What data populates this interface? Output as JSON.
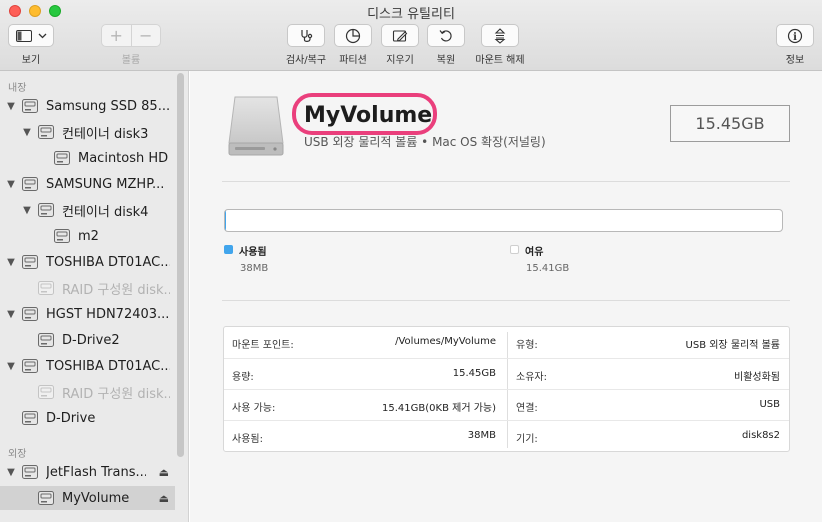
{
  "window": {
    "title": "디스크 유틸리티"
  },
  "toolbar": {
    "view_label": "보기",
    "volume_label": "볼륨",
    "volume_add": "+",
    "volume_remove": "−",
    "first_aid_label": "검사/복구",
    "partition_label": "파티션",
    "erase_label": "지우기",
    "restore_label": "복원",
    "unmount_label": "마운트 해제",
    "info_label": "정보"
  },
  "sidebar": {
    "internal_header": "내장",
    "external_header": "외장",
    "items": [
      {
        "label": "Samsung SSD 85...",
        "kind": "disk"
      },
      {
        "label": "컨테이너 disk3",
        "kind": "container"
      },
      {
        "label": "Macintosh HD",
        "kind": "volume"
      },
      {
        "label": "SAMSUNG MZHP...",
        "kind": "disk"
      },
      {
        "label": "컨테이너 disk4",
        "kind": "container"
      },
      {
        "label": "m2",
        "kind": "volume"
      },
      {
        "label": "TOSHIBA DT01AC...",
        "kind": "disk"
      },
      {
        "label": "RAID 구성원 disk...",
        "kind": "raid"
      },
      {
        "label": "HGST HDN72403...",
        "kind": "disk"
      },
      {
        "label": "D-Drive2",
        "kind": "volume"
      },
      {
        "label": "TOSHIBA DT01AC...",
        "kind": "disk"
      },
      {
        "label": "RAID 구성원 disk...",
        "kind": "raid"
      },
      {
        "label": "D-Drive",
        "kind": "volume"
      },
      {
        "label": "JetFlash Trans...",
        "kind": "disk"
      },
      {
        "label": "MyVolume",
        "kind": "volume"
      }
    ],
    "eject_glyph": "⏏"
  },
  "volume": {
    "name": "MyVolume",
    "subtitle": "USB 외장 물리적 볼륨 • Mac OS 확장(저널링)",
    "size": "15.45GB",
    "used_fraction": 0.0025
  },
  "usage": {
    "used_title": "사용됨",
    "used_value": "38MB",
    "free_title": "여유",
    "free_value": "15.41GB",
    "used_color": "#41a5ec",
    "free_color": "#ffffff"
  },
  "info": {
    "left": [
      {
        "key": "마운트 포인트:",
        "value": "/Volumes/MyVolume"
      },
      {
        "key": "용량:",
        "value": "15.45GB"
      },
      {
        "key": "사용 가능:",
        "value": "15.41GB(0KB 제거 가능)"
      },
      {
        "key": "사용됨:",
        "value": "38MB"
      }
    ],
    "right": [
      {
        "key": "유형:",
        "value": "USB 외장 물리적 볼륨"
      },
      {
        "key": "소유자:",
        "value": "비활성화됨"
      },
      {
        "key": "연결:",
        "value": "USB"
      },
      {
        "key": "기기:",
        "value": "disk8s2"
      }
    ]
  },
  "colors": {
    "highlight": "#ea3f7c",
    "accent": "#41a5ec"
  }
}
